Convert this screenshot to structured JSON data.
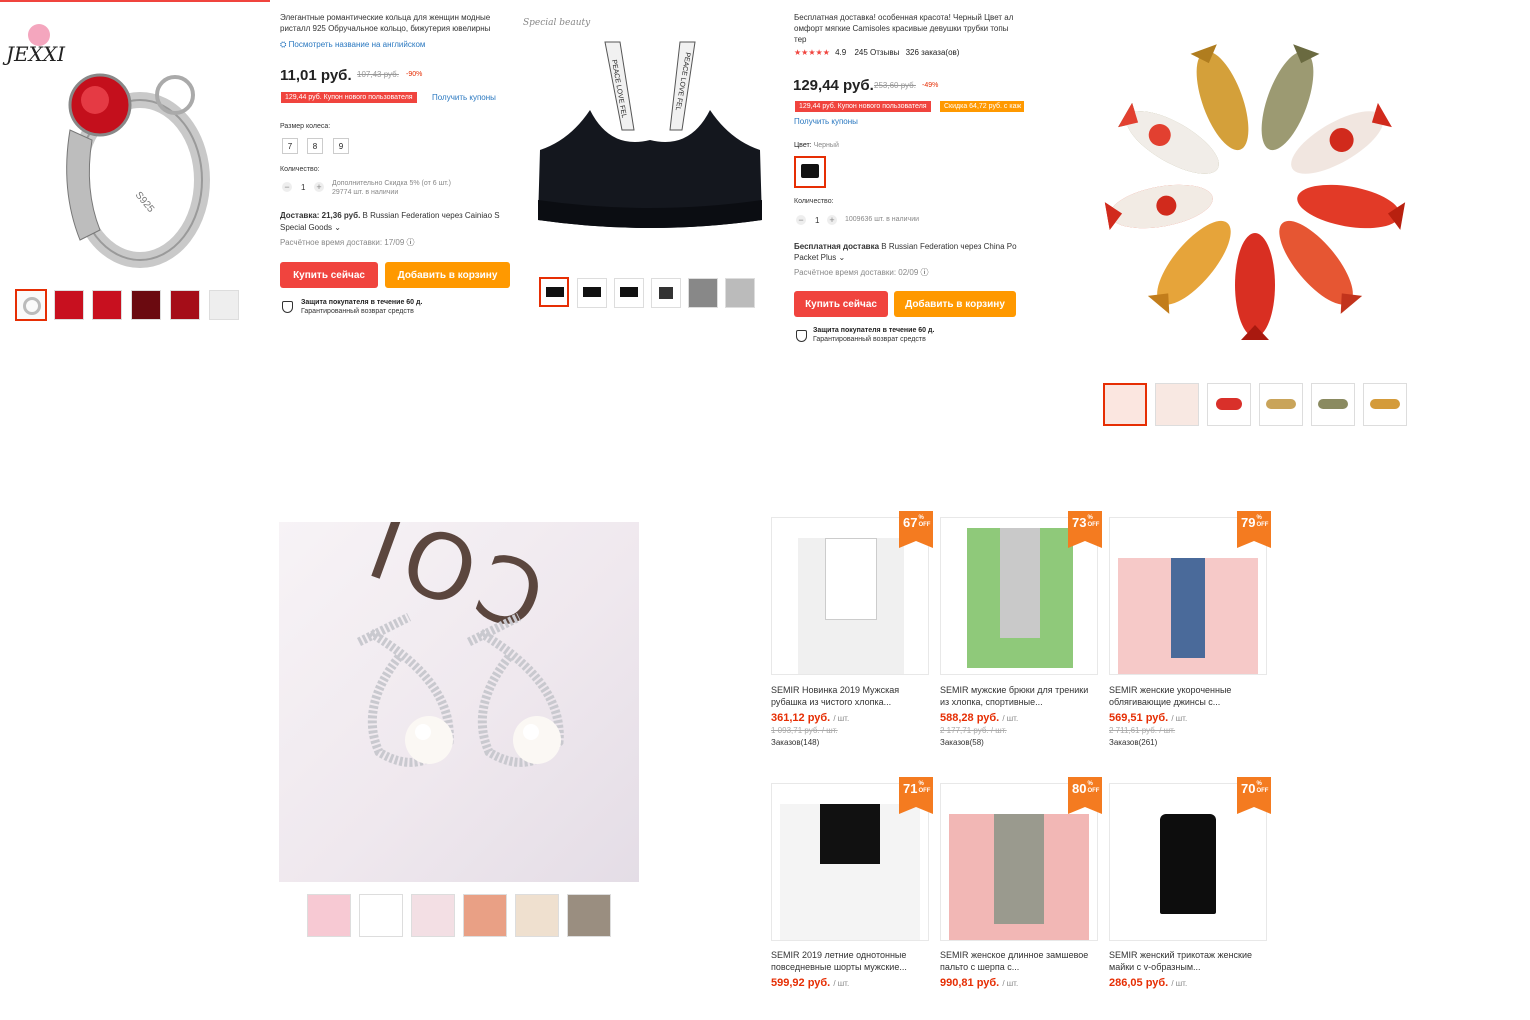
{
  "top_line_color": "#f0443e",
  "ring": {
    "logo": "JEXXI",
    "title": "Элегантные романтические кольца для женщин модные ристалл 925 Обручальное кольцо, бижутерия ювелирны",
    "translate_link": "Посмотреть название на английском",
    "price": "11,01 руб.",
    "old_price": "107,43 руб.",
    "discount": "-90%",
    "coupon": "129,44 руб. Купон нового пользователя",
    "get_coupons": "Получить купоны",
    "size_label": "Размер колеса:",
    "sizes": [
      "7",
      "8",
      "9"
    ],
    "qty_label": "Количество:",
    "qty": "1",
    "qty_note": "Дополнительно Скидка 5% (от 6 шт.)",
    "stock": "29774 шт. в наличии",
    "shipping_bold": "Доставка: 21,36 руб.",
    "shipping_rest": " В Russian Federation через Cainiao S",
    "shipping_line2": "Special Goods",
    "delivery_time": "Расчётное время доставки: 17/09",
    "buy_now": "Купить сейчас",
    "add_cart": "Добавить в корзину",
    "protection": "Защита покупателя в течение 60 д.",
    "refund": "Гарантированный возврат средств",
    "image_text": "S925"
  },
  "bra": {
    "logo": "Special beauty",
    "strap_text": "PEACE LOVE FEL"
  },
  "cami": {
    "title": "Бесплатная доставка! особенная красота! Черный Цвет ал омфорт мягкие Camisoles красивые девушки трубки топы тер",
    "stars": "★★★★★",
    "rating": "4.9",
    "reviews": "245 Отзывы",
    "orders": "326 заказа(ов)",
    "price": "129,44 руб.",
    "old_price": "253,60 руб.",
    "discount": "-49%",
    "coupon": "129,44 руб. Купон нового пользователя",
    "coupon2": "Скидка 64,72 руб. с каж",
    "get_coupons": "Получить купоны",
    "color_label": "Цвет:",
    "color_value": "Черный",
    "qty_label": "Количество:",
    "qty": "1",
    "stock": "1009636 шт. в наличии",
    "shipping_bold": "Бесплатная доставка",
    "shipping_rest": " В Russian Federation через China Po",
    "shipping_line2": "Packet Plus",
    "delivery_time": "Расчётное время доставки: 02/09",
    "buy_now": "Купить сейчас",
    "add_cart": "Добавить в корзину",
    "protection": "Защита покупателя в течение 60 д.",
    "refund": "Гарантированный возврат средств"
  },
  "earrings": {
    "bg_text": "COL"
  },
  "products": [
    {
      "discount": "67",
      "title": "SEMIR Новинка 2019 Мужская рубашка из чистого хлопка...",
      "price": "361,12 руб.",
      "unit": "/ шт.",
      "old_price": "1 093,71 руб. / шт.",
      "orders": "Заказов(148)",
      "bg": "#f4f4f4"
    },
    {
      "discount": "73",
      "title": "SEMIR мужские брюки для треники из хлопка, спортивные...",
      "price": "588,28 руб.",
      "unit": "/ шт.",
      "old_price": "2 177,71 руб. / шт.",
      "orders": "Заказов(58)",
      "bg": "#8fc97a"
    },
    {
      "discount": "79",
      "title": "SEMIR женские укороченные облягивающие джинсы с...",
      "price": "569,51 руб.",
      "unit": "/ шт.",
      "old_price": "2 711,61 руб. / шт.",
      "orders": "Заказов(261)",
      "bg": "#f6c9c8"
    },
    {
      "discount": "71",
      "title": "SEMIR 2019 летние однотонные повседневные шорты мужские...",
      "price": "599,92 руб.",
      "unit": "/ шт.",
      "old_price": "",
      "orders": "",
      "bg": "#f4f4f4"
    },
    {
      "discount": "80",
      "title": "SEMIR женское длинное замшевое пальто с шерпа с...",
      "price": "990,81 руб.",
      "unit": "/ шт.",
      "old_price": "",
      "orders": "",
      "bg": "#f2b7b5"
    },
    {
      "discount": "70",
      "title": "SEMIR женский трикотаж женские майки с v-образным...",
      "price": "286,05 руб.",
      "unit": "/ шт.",
      "old_price": "",
      "orders": "",
      "bg": "#ffffff"
    }
  ],
  "off_label": "% OFF",
  "icons": [
    "shield-icon",
    "translate-icon",
    "question-icon",
    "chevron-down-icon",
    "minus-icon",
    "plus-icon"
  ]
}
